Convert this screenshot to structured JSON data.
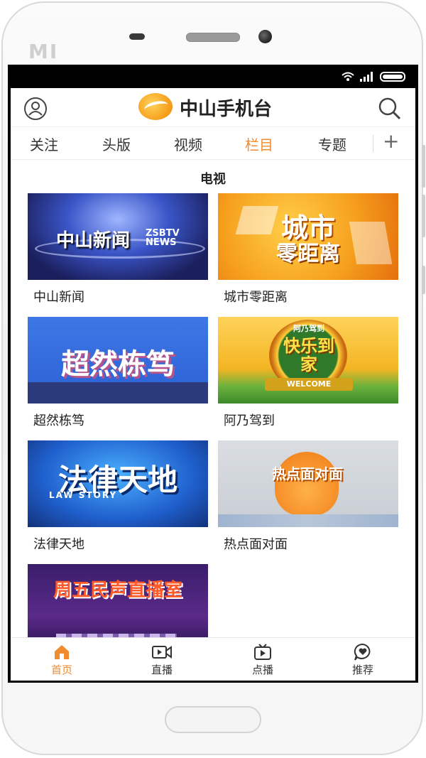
{
  "device": {
    "brand": "MI"
  },
  "header": {
    "title": "中山手机台"
  },
  "tabs": [
    {
      "label": "关注"
    },
    {
      "label": "头版"
    },
    {
      "label": "视频"
    },
    {
      "label": "栏目",
      "active": true
    },
    {
      "label": "专题"
    }
  ],
  "tabs_more": "+",
  "section": {
    "title": "电视"
  },
  "programs": [
    {
      "label": "中山新闻",
      "art_main": "中山新闻",
      "art_sub": "ZSBTV NEWS"
    },
    {
      "label": "城市零距离",
      "art_main": "城市",
      "art_sub": "零距离"
    },
    {
      "label": "超然栋笃",
      "art_main": "超然栋笃"
    },
    {
      "label": "阿乃驾到",
      "art_main": "快乐到家",
      "art_sub": "阿乃驾到",
      "art_banner": "WELCOME"
    },
    {
      "label": "法律天地",
      "art_main": "法律天地",
      "art_sub": "LAW STORY"
    },
    {
      "label": "热点面对面",
      "art_main": "热点面对面"
    },
    {
      "art_main": "周五民声直播室"
    }
  ],
  "bottom_nav": [
    {
      "label": "首页",
      "icon": "home-icon",
      "active": true
    },
    {
      "label": "直播",
      "icon": "live-camera-icon"
    },
    {
      "label": "点播",
      "icon": "tv-play-icon"
    },
    {
      "label": "推荐",
      "icon": "heart-chat-icon"
    }
  ],
  "colors": {
    "accent": "#f08c2e",
    "text": "#222222"
  }
}
